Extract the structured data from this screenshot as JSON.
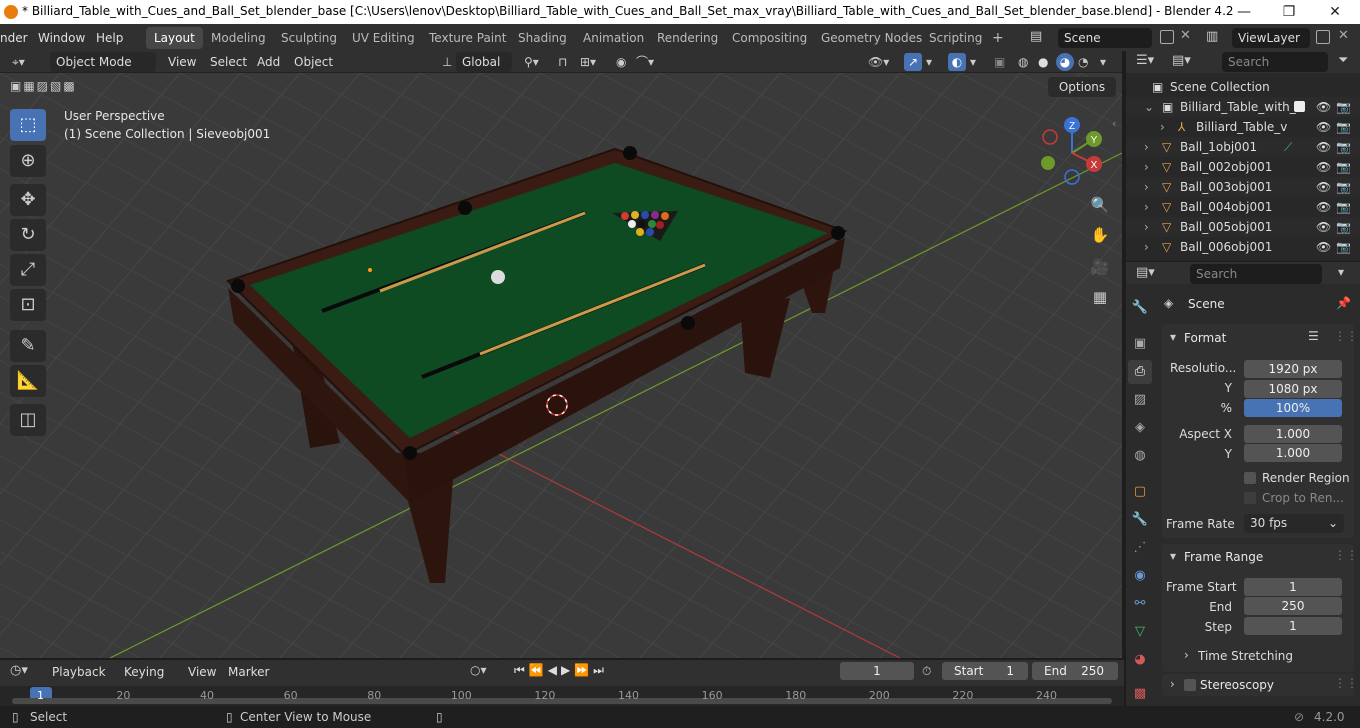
{
  "window": {
    "title": "* Billiard_Table_with_Cues_and_Ball_Set_blender_base [C:\\Users\\lenov\\Desktop\\Billiard_Table_with_Cues_and_Ball_Set_max_vray\\Billiard_Table_with_Cues_and_Ball_Set_blender_base.blend] - Blender 4.2",
    "controls": [
      "—",
      "❐",
      "✕"
    ]
  },
  "menubar": {
    "items": [
      "nder",
      "Window",
      "Help"
    ],
    "workspaces": [
      "Layout",
      "Modeling",
      "Sculpting",
      "UV Editing",
      "Texture Paint",
      "Shading",
      "Animation",
      "Rendering",
      "Compositing",
      "Geometry Nodes",
      "Scripting"
    ],
    "active_workspace": "Layout",
    "add_tab": "+",
    "scene": "Scene",
    "view_layer": "ViewLayer"
  },
  "viewport_header": {
    "mode": "Object Mode",
    "menus": [
      "View",
      "Select",
      "Add",
      "Object"
    ],
    "orientation": "Global",
    "options": "Options"
  },
  "viewport": {
    "perspective": "User Perspective",
    "collection_info": "(1) Scene Collection | Sieveobj001",
    "gizmo": {
      "x": "X",
      "y": "Y",
      "z": "Z"
    },
    "colors": {
      "grid": "#3a3a3a",
      "felt": "#0e4a22",
      "wood": "#3a1c14",
      "x_axis": "#b23a3a",
      "y_axis": "#6d9a2a"
    }
  },
  "tools": [
    "select-box",
    "cursor",
    "move",
    "rotate",
    "scale",
    "transform",
    "annotate",
    "measure",
    "add-cube"
  ],
  "outliner": {
    "search_placeholder": "Search",
    "rows": [
      {
        "name": "Scene Collection",
        "icon": "collection-icon"
      },
      {
        "name": "Billiard_Table_with_",
        "icon": "collection-icon"
      },
      {
        "name": "Billiard_Table_v",
        "icon": "armature-icon"
      },
      {
        "name": "Ball_1obj001",
        "icon": "mesh-icon"
      },
      {
        "name": "Ball_002obj001",
        "icon": "mesh-icon"
      },
      {
        "name": "Ball_003obj001",
        "icon": "mesh-icon"
      },
      {
        "name": "Ball_004obj001",
        "icon": "mesh-icon"
      },
      {
        "name": "Ball_005obj001",
        "icon": "mesh-icon"
      },
      {
        "name": "Ball_006obj001",
        "icon": "mesh-icon"
      }
    ]
  },
  "properties": {
    "search_placeholder": "Search",
    "context": "Scene",
    "format": {
      "title": "Format",
      "resolution_label": "Resolutio...",
      "res_x": "1920 px",
      "y_label": "Y",
      "res_y": "1080 px",
      "pct_label": "%",
      "pct": "100%",
      "aspect_x_label": "Aspect X",
      "aspect_x": "1.000",
      "aspect_y_label": "Y",
      "aspect_y": "1.000",
      "render_region": "Render Region",
      "crop": "Crop to Ren...",
      "frame_rate_label": "Frame Rate",
      "frame_rate": "30 fps"
    },
    "frame_range": {
      "title": "Frame Range",
      "start_label": "Frame Start",
      "start": "1",
      "end_label": "End",
      "end": "250",
      "step_label": "Step",
      "step": "1"
    },
    "time_stretching": "Time Stretching",
    "stereoscopy": "Stereoscopy"
  },
  "timeline": {
    "menus": [
      "Playback",
      "Keying",
      "View",
      "Marker"
    ],
    "current_frame": "1",
    "start_label": "Start",
    "start": "1",
    "end_label": "End",
    "end": "250",
    "ticks": [
      "1",
      "20",
      "40",
      "60",
      "80",
      "100",
      "120",
      "140",
      "160",
      "180",
      "200",
      "220",
      "240"
    ]
  },
  "statusbar": {
    "select": "Select",
    "center_view": "Center View to Mouse",
    "version": "4.2.0"
  }
}
